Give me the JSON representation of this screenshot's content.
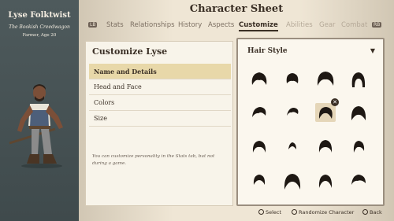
{
  "character": {
    "name": "Lyse Folktwist",
    "title": "The Bookish Creedwagon",
    "occupation": "Farmer, Age 20"
  },
  "header": {
    "title": "Character Sheet",
    "left_button": "LB",
    "right_button": "RB",
    "tabs": [
      {
        "label": "Stats",
        "state": "normal"
      },
      {
        "label": "Relationships",
        "state": "normal"
      },
      {
        "label": "History",
        "state": "normal"
      },
      {
        "label": "Aspects",
        "state": "normal"
      },
      {
        "label": "Customize",
        "state": "active"
      },
      {
        "label": "Abilities",
        "state": "disabled"
      },
      {
        "label": "Gear",
        "state": "disabled"
      },
      {
        "label": "Combat",
        "state": "disabled"
      }
    ]
  },
  "customize": {
    "title": "Customize Lyse",
    "menu": [
      {
        "label": "Name and Details",
        "active": true
      },
      {
        "label": "Head and Face",
        "active": false
      },
      {
        "label": "Colors",
        "active": false
      },
      {
        "label": "Size",
        "active": false
      }
    ],
    "note": "You can customize personality in the Stats tab, but not during a game."
  },
  "hair": {
    "title": "Hair Style",
    "caret_icon": "chevron-down-icon",
    "selected_index": 6,
    "styles": 16
  },
  "footer": {
    "select": "Select",
    "randomize": "Randomize Character",
    "back": "Back"
  },
  "colors": {
    "left_panel": "#4e5a5c",
    "accent": "#e8d8a9",
    "text": "#3a2f25"
  }
}
